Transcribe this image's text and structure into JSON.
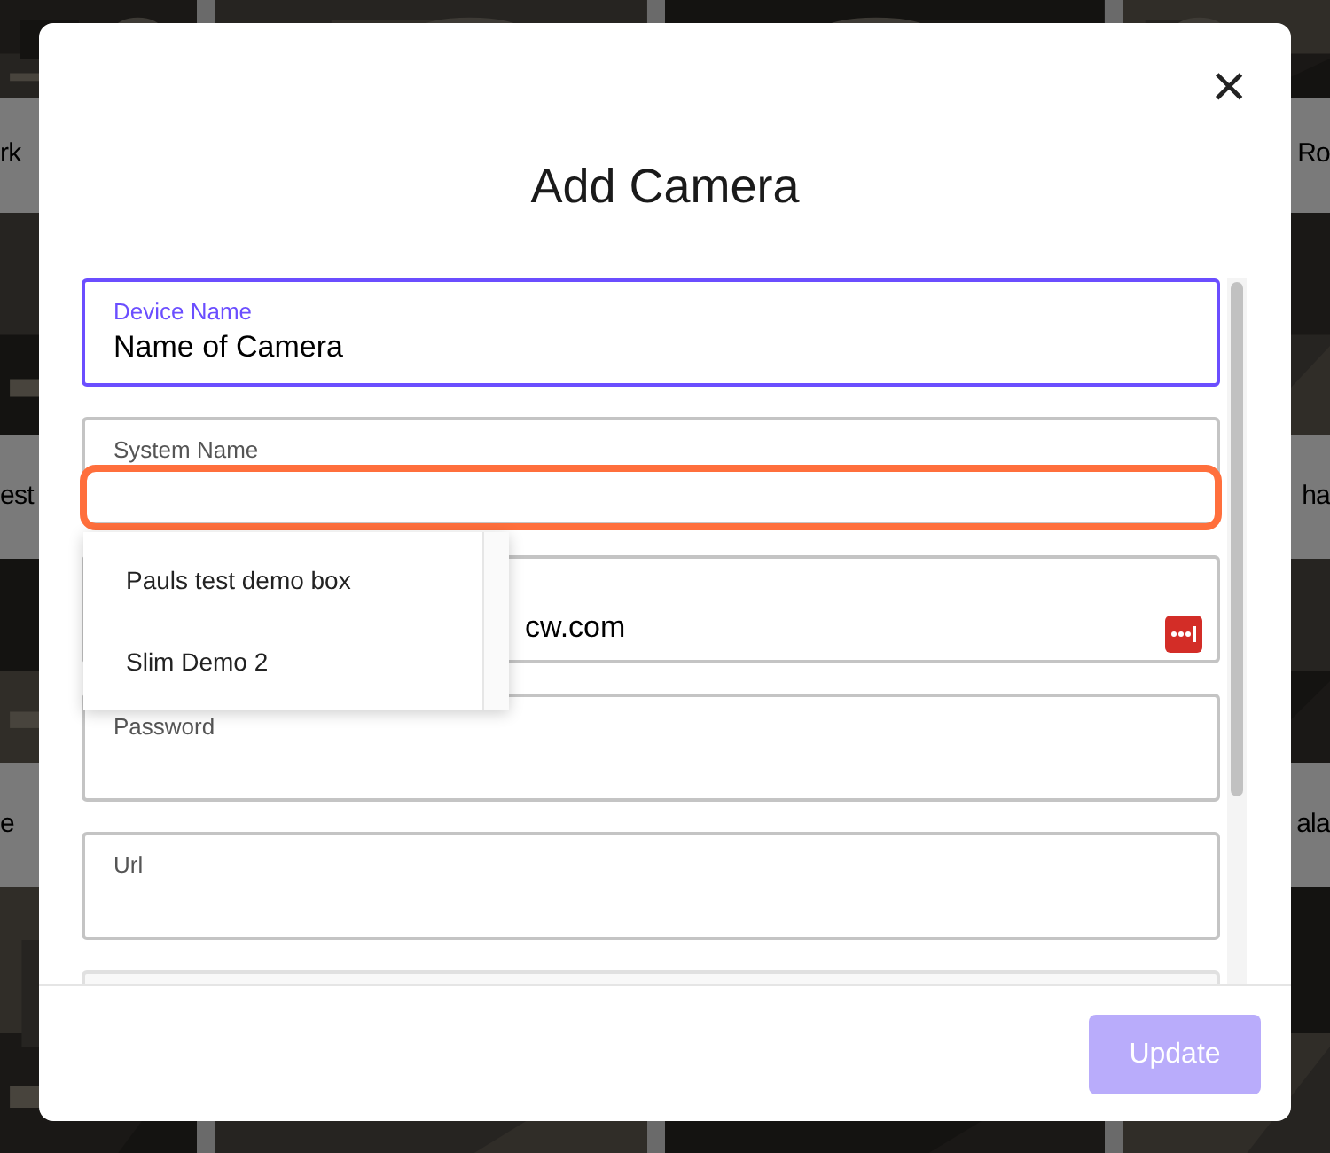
{
  "background": {
    "rows": [
      {
        "left_label": "rk",
        "right_label": "Ro"
      },
      {
        "left_label": "est",
        "right_label": "ha"
      },
      {
        "left_label": "e",
        "right_label": "ala"
      }
    ]
  },
  "dialog": {
    "title": "Add Camera",
    "close": "×",
    "fields": [
      {
        "label": "Device Name",
        "value": "Name of Camera",
        "focused": true
      },
      {
        "label": "System Name",
        "focused": false,
        "highlighted": true
      },
      {
        "value": "cw.com",
        "focused": false,
        "password_manager": true
      },
      {
        "label": "Password",
        "focused": false
      },
      {
        "label": "Url",
        "focused": false
      }
    ],
    "dropdown": {
      "options": [
        {
          "label": "Pauls test demo box",
          "selected": false
        },
        {
          "label": "Slim Demo 2",
          "selected": false
        }
      ]
    },
    "update_button": {
      "label": "Update",
      "disabled": true
    }
  }
}
